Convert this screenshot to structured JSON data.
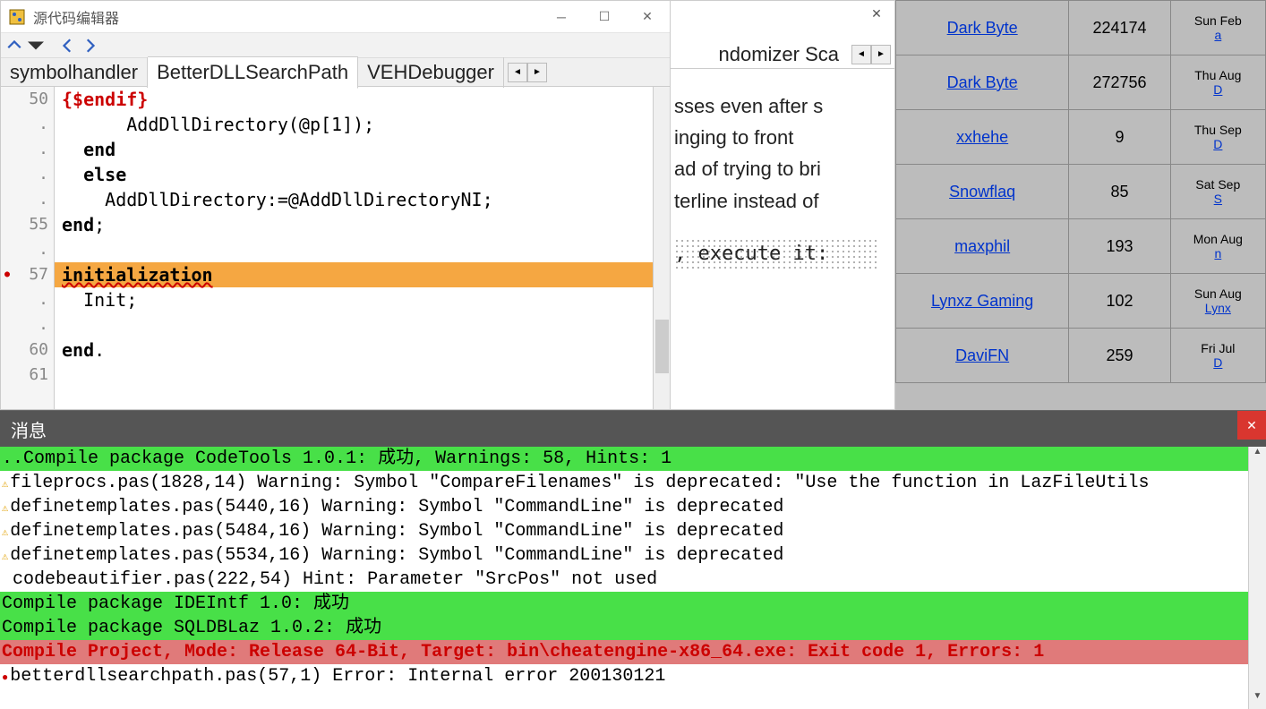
{
  "ide": {
    "title": "源代码编辑器",
    "tabs": [
      "symbolhandler",
      "BetterDLLSearchPath",
      "VEHDebugger"
    ],
    "active_tab": 1,
    "gutter": [
      "50",
      ".",
      ".",
      ".",
      ".",
      "55",
      ".",
      "57",
      ".",
      ".",
      "60",
      "61"
    ],
    "code": [
      {
        "t": "{$endif}",
        "cls": "red"
      },
      {
        "t": "      AddDllDirectory(@p[1]);"
      },
      {
        "t": "  end",
        "cls": "kw"
      },
      {
        "t": "  else",
        "cls": "kw"
      },
      {
        "t": "    AddDllDirectory:=@AddDllDirectoryNI;"
      },
      {
        "t": "end;",
        "cls": "kw"
      },
      {
        "t": ""
      },
      {
        "t": "initialization",
        "cls": "hl"
      },
      {
        "t": "  Init;"
      },
      {
        "t": ""
      },
      {
        "t": "end.",
        "cls": "kw"
      },
      {
        "t": ""
      }
    ]
  },
  "side": {
    "tab": "ndomizer Sca",
    "lines": [
      "sses even after s",
      "inging to front",
      "ad of trying to bri",
      "terline instead of"
    ],
    "mono": ", execute it:"
  },
  "forum": {
    "rows": [
      {
        "user": "Dark Byte",
        "num": "224174",
        "date": "Sun Feb",
        "by": "a"
      },
      {
        "user": "Dark Byte",
        "num": "272756",
        "date": "Thu Aug",
        "by": "D"
      },
      {
        "user": "xxhehe",
        "num": "9",
        "date": "Thu Sep",
        "by": "D"
      },
      {
        "user": "Snowflaq",
        "num": "85",
        "date": "Sat Sep",
        "by": "S"
      },
      {
        "user": "maxphil",
        "num": "193",
        "date": "Mon Aug",
        "by": "n"
      },
      {
        "user": "Lynxz Gaming",
        "num": "102",
        "date": "Sun Aug",
        "by": "Lynx"
      },
      {
        "user": "DaviFN",
        "num": "259",
        "date": "Fri Jul",
        "by": "D"
      }
    ]
  },
  "messages": {
    "title": "消息",
    "lines": [
      {
        "cls": "green",
        "t": "..Compile package CodeTools 1.0.1: 成功, Warnings: 58, Hints: 1"
      },
      {
        "ico": "warn",
        "t": "fileprocs.pas(1828,14) Warning: Symbol \"CompareFilenames\" is deprecated: \"Use the function in LazFileUtils"
      },
      {
        "ico": "warn",
        "t": "definetemplates.pas(5440,16) Warning: Symbol \"CommandLine\" is deprecated"
      },
      {
        "ico": "warn",
        "t": "definetemplates.pas(5484,16) Warning: Symbol \"CommandLine\" is deprecated"
      },
      {
        "ico": "warn",
        "t": "definetemplates.pas(5534,16) Warning: Symbol \"CommandLine\" is deprecated"
      },
      {
        "t": " codebeautifier.pas(222,54) Hint: Parameter \"SrcPos\" not used"
      },
      {
        "cls": "green",
        "t": "Compile package IDEIntf 1.0: 成功"
      },
      {
        "cls": "green",
        "t": "Compile package SQLDBLaz 1.0.2: 成功"
      },
      {
        "cls": "red",
        "t": "Compile Project, Mode: Release 64-Bit, Target: bin\\cheatengine-x86_64.exe: Exit code 1, Errors: 1"
      },
      {
        "ico": "err",
        "t": "betterdllsearchpath.pas(57,1) Error: Internal error 200130121"
      }
    ]
  }
}
